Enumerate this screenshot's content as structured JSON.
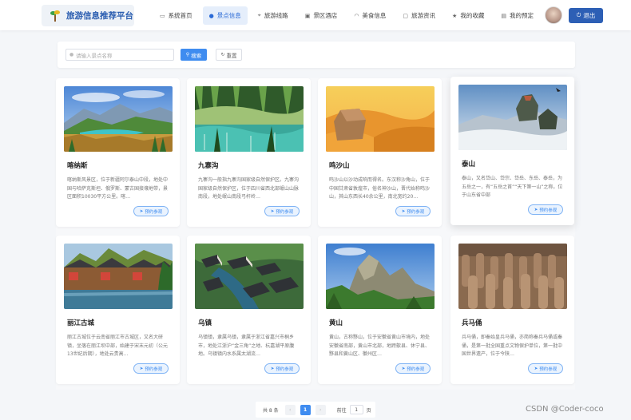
{
  "header": {
    "logo_text": "旅游信息推荐平台",
    "nav": [
      {
        "label": "系统首页",
        "icon": "monitor-icon",
        "active": false
      },
      {
        "label": "景点信息",
        "icon": "location-pin-icon",
        "active": true
      },
      {
        "label": "旅游线路",
        "icon": "route-icon",
        "active": false
      },
      {
        "label": "景区酒店",
        "icon": "hotel-icon",
        "active": false
      },
      {
        "label": "美食信息",
        "icon": "food-bowl-icon",
        "active": false
      },
      {
        "label": "旅游资讯",
        "icon": "chat-bubble-icon",
        "active": false
      },
      {
        "label": "我的收藏",
        "icon": "star-icon",
        "active": false
      },
      {
        "label": "我的预定",
        "icon": "document-icon",
        "active": false
      }
    ],
    "logout_label": "退出"
  },
  "search": {
    "placeholder": "请输入景点名称",
    "search_label": "搜索",
    "reset_label": "重置"
  },
  "cards": [
    {
      "name": "喀纳斯",
      "desc": "喀纳斯风景区，位于新疆阿尔泰山中段，地处中国与哈萨克斯坦、俄罗斯、蒙古国接壤地带，景区面积10030平方公里。喀…",
      "book_label": "预约参观"
    },
    {
      "name": "九寨沟",
      "desc": "九寨沟一般指九寨沟国家级自然保护区。九寨沟国家级自然保护区，位于四川省西北部岷山山脉南段，地处岷山南段弓杆岭…",
      "book_label": "预约参观"
    },
    {
      "name": "鸣沙山",
      "desc": "鸣沙山以沙动成响而得名。东汉称沙角山，位于中国甘肃省敦煌市，俗名神沙山，晋代始称鸣沙山，其山东西长40余公里，南北宽约20…",
      "book_label": "预约参观"
    },
    {
      "name": "泰山",
      "desc": "泰山，又名岱山、岱宗、岱岳、东岳、泰岳，为五岳之一，有“五岳之首”“天下第一山”之称。位于山东省中部",
      "book_label": "预约参观"
    },
    {
      "name": "丽江古城",
      "desc": "丽江古城位于云南省丽江市古城区，又名大研镇，坐落在丽江坝中部，始建于宋末元初（公元13世纪后期），地处云贵高…",
      "book_label": "预约参观"
    },
    {
      "name": "乌镇",
      "desc": "乌镇镇，隶属乌镇，隶属于浙江省嘉兴市桐乡市，地处江浙沪“金三角”之地、杭嘉湖平原腹地。乌镇镇内水系属太湖流…",
      "book_label": "预约参观"
    },
    {
      "name": "黄山",
      "desc": "黄山，古称黟山，位于安徽省黄山市境内，地处安徽省南部，黄山市北部，地跨歙县、休宁县、黟县和黄山区、徽州区…",
      "book_label": "预约参观"
    },
    {
      "name": "兵马俑",
      "desc": "兵马俑，即秦始皇兵马俑，亦简称秦兵马俑或秦俑，是第一批全国重点文物保护单位，第一批中国世界遗产，位于今陕…",
      "book_label": "预约参观"
    }
  ],
  "pagination": {
    "total_text": "共 8 条",
    "current_page": "1",
    "prev": "‹",
    "next": "›",
    "goto_label": "前往",
    "goto_value": "1",
    "page_unit": "页"
  },
  "watermark": "CSDN @Coder-coco"
}
